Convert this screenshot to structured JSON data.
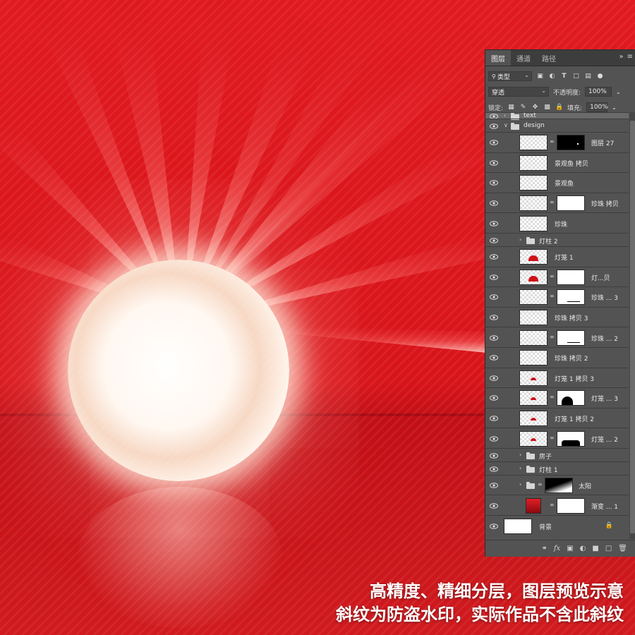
{
  "panel": {
    "tabs": [
      "图层",
      "通道",
      "路径"
    ],
    "filter_kind": "类型",
    "blend_mode": "穿透",
    "opacity_label": "不透明度:",
    "opacity_value": "100%",
    "lock_label": "锁定:",
    "fill_label": "填充:",
    "fill_value": "100%"
  },
  "layers": [
    {
      "name": "text",
      "kind": "group",
      "collapsed": true
    },
    {
      "name": "design",
      "kind": "group",
      "expanded": true
    },
    {
      "name": "图层 27",
      "kind": "layer",
      "mask": "black"
    },
    {
      "name": "景观鱼 拷贝",
      "kind": "layer"
    },
    {
      "name": "景观鱼",
      "kind": "layer"
    },
    {
      "name": "珍珠 拷贝",
      "kind": "layer",
      "mask": "white"
    },
    {
      "name": "珍珠",
      "kind": "layer"
    },
    {
      "name": "灯柱 2",
      "kind": "group",
      "collapsed": true
    },
    {
      "name": "灯笼 1",
      "kind": "layer",
      "thumb": "lantern"
    },
    {
      "name": "灯...贝",
      "kind": "layer",
      "thumb": "lantern",
      "mask": "white"
    },
    {
      "name": "珍珠 ... 3",
      "kind": "layer",
      "mask": "line"
    },
    {
      "name": "珍珠 拷贝 3",
      "kind": "layer"
    },
    {
      "name": "珍珠 ... 2",
      "kind": "layer",
      "mask": "line"
    },
    {
      "name": "珍珠 拷贝 2",
      "kind": "layer"
    },
    {
      "name": "灯笼 1 拷贝 3",
      "kind": "layer",
      "thumb": "dot"
    },
    {
      "name": "灯笼 ... 3",
      "kind": "layer",
      "thumb": "dot",
      "mask": "blob"
    },
    {
      "name": "灯笼 1 拷贝 2",
      "kind": "layer",
      "thumb": "dot"
    },
    {
      "name": "灯笼 ... 2",
      "kind": "layer",
      "thumb": "dot",
      "mask": "blob2"
    },
    {
      "name": "房子",
      "kind": "group",
      "collapsed": true
    },
    {
      "name": "灯柱 1",
      "kind": "group",
      "collapsed": true
    },
    {
      "name": "太阳",
      "kind": "group",
      "collapsed": true,
      "mask": "gradient"
    },
    {
      "name": "渐变 ... 1",
      "kind": "adjustment",
      "mask": "white"
    },
    {
      "name": "背景",
      "kind": "background",
      "locked": true
    }
  ],
  "watermark": {
    "line1": "高精度、精细分层，图层预览示意",
    "line2": "斜纹为防盗水印，实际作品不含此斜纹"
  },
  "colors": {
    "artwork_red": "#e01a20",
    "panel_bg": "#535353",
    "panel_dark": "#3d3d3d"
  }
}
